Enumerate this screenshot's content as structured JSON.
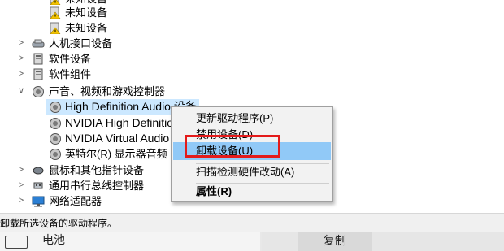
{
  "tree": {
    "rows": [
      {
        "label": "未知设备",
        "type": "warn-device",
        "partial": true
      },
      {
        "label": "未知设备",
        "type": "warn-device"
      },
      {
        "label": "未知设备",
        "type": "warn-device"
      },
      {
        "label": "人机接口设备",
        "type": "hid",
        "arrow": ">"
      },
      {
        "label": "软件设备",
        "type": "software",
        "arrow": ">"
      },
      {
        "label": "软件组件",
        "type": "software",
        "arrow": ">"
      },
      {
        "label": "声音、视频和游戏控制器",
        "type": "speaker",
        "arrow": "v"
      },
      {
        "label": "High Definition Audio 设备",
        "type": "speaker",
        "selected": true
      },
      {
        "label": "NVIDIA High Definitio",
        "type": "speaker"
      },
      {
        "label": "NVIDIA Virtual Audio",
        "type": "speaker"
      },
      {
        "label": "英特尔(R) 显示器音频",
        "type": "speaker"
      },
      {
        "label": "鼠标和其他指针设备",
        "type": "mouse",
        "arrow": ">"
      },
      {
        "label": "通用串行总线控制器",
        "type": "usb",
        "arrow": ">"
      },
      {
        "label": "网络适配器",
        "type": "network",
        "arrow": ">"
      }
    ]
  },
  "context_menu": {
    "items": [
      {
        "label": "更新驱动程序(P)"
      },
      {
        "label": "禁用设备(D)"
      },
      {
        "label": "卸载设备(U)",
        "highlighted": true
      },
      {
        "label": "扫描检测硬件改动(A)"
      },
      {
        "label": "属性(R)",
        "bold": true
      }
    ]
  },
  "statusbar": {
    "text": "卸载所选设备的驱动程序。"
  },
  "below": {
    "battery_label": "电池",
    "copy_label": "复制"
  },
  "colors": {
    "selection": "#cce8ff",
    "menu_highlight": "#91c9f7",
    "red_box": "#e41b1b"
  }
}
